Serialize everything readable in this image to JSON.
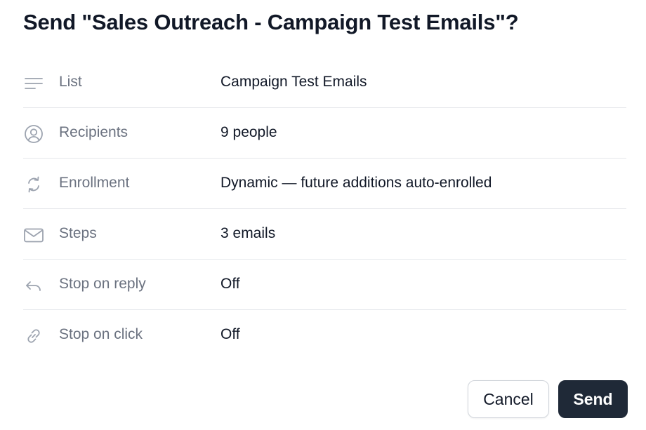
{
  "dialog": {
    "title": "Send \"Sales Outreach - Campaign Test Emails\"?"
  },
  "details": [
    {
      "icon": "list-lines-icon",
      "label": "List",
      "value": "Campaign Test Emails"
    },
    {
      "icon": "user-circle-icon",
      "label": "Recipients",
      "value": "9 people"
    },
    {
      "icon": "sync-arrows-icon",
      "label": "Enrollment",
      "value": "Dynamic — future additions auto-enrolled"
    },
    {
      "icon": "envelope-icon",
      "label": "Steps",
      "value": "3 emails"
    },
    {
      "icon": "reply-arrow-icon",
      "label": "Stop on reply",
      "value": "Off"
    },
    {
      "icon": "link-icon",
      "label": "Stop on click",
      "value": "Off"
    }
  ],
  "actions": {
    "cancel_label": "Cancel",
    "send_label": "Send"
  },
  "colors": {
    "primary_button": "#1f2937",
    "label_text": "#6b7280",
    "icon": "#9ca3af",
    "divider": "#e5e7eb"
  }
}
